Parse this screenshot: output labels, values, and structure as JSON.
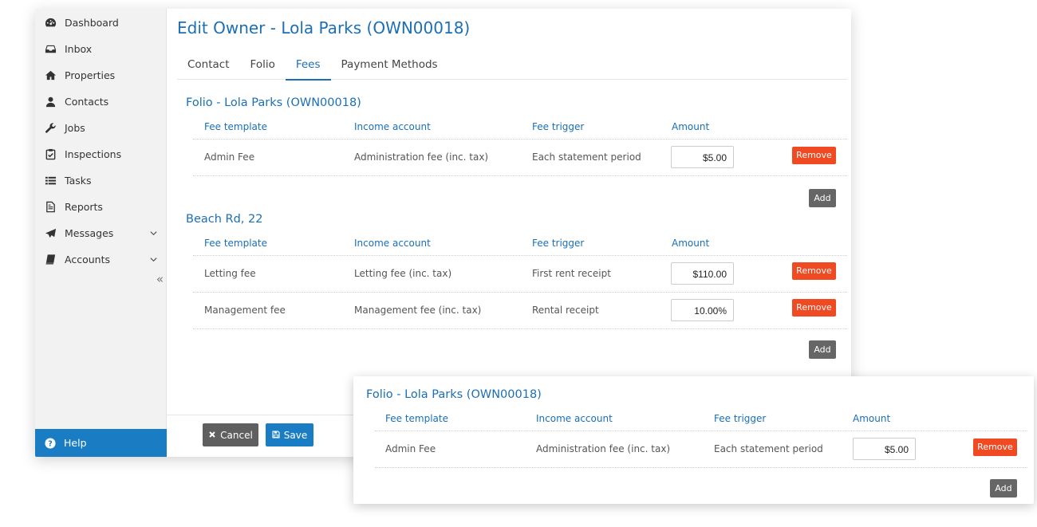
{
  "sidebar": {
    "items": [
      {
        "label": "Dashboard",
        "icon": "dashboard-icon"
      },
      {
        "label": "Inbox",
        "icon": "inbox-icon"
      },
      {
        "label": "Properties",
        "icon": "home-icon"
      },
      {
        "label": "Contacts",
        "icon": "user-icon"
      },
      {
        "label": "Jobs",
        "icon": "wrench-icon"
      },
      {
        "label": "Inspections",
        "icon": "clipboard-check-icon"
      },
      {
        "label": "Tasks",
        "icon": "list-icon"
      },
      {
        "label": "Reports",
        "icon": "document-icon"
      },
      {
        "label": "Messages",
        "icon": "paper-plane-icon"
      },
      {
        "label": "Accounts",
        "icon": "book-icon"
      }
    ],
    "collapse_glyph": "«",
    "help_label": "Help"
  },
  "page_title": "Edit Owner - Lola Parks (OWN00018)",
  "tabs": [
    "Contact",
    "Folio",
    "Fees",
    "Payment Methods"
  ],
  "active_tab": "Fees",
  "columns": {
    "fee_template": "Fee template",
    "income_account": "Income account",
    "fee_trigger": "Fee trigger",
    "amount": "Amount"
  },
  "sections": [
    {
      "title": "Folio - Lola Parks (OWN00018)",
      "rows": [
        {
          "template": "Admin Fee",
          "account": "Administration fee (inc. tax)",
          "trigger": "Each statement period",
          "amount": "$5.00"
        }
      ]
    },
    {
      "title": "Beach Rd, 22",
      "rows": [
        {
          "template": "Letting fee",
          "account": "Letting fee (inc. tax)",
          "trigger": "First rent receipt",
          "amount": "$110.00"
        },
        {
          "template": "Management fee",
          "account": "Management fee (inc. tax)",
          "trigger": "Rental receipt",
          "amount": "10.00%"
        }
      ]
    }
  ],
  "buttons": {
    "remove": "Remove",
    "add": "Add",
    "cancel": "Cancel",
    "save": "Save"
  },
  "popup": {
    "title": "Folio - Lola Parks (OWN00018)",
    "row": {
      "template": "Admin Fee",
      "account": "Administration fee (inc. tax)",
      "trigger": "Each statement period",
      "amount": "$5.00"
    }
  },
  "colors": {
    "accent": "#1a7dc4",
    "remove": "#f04a23",
    "add": "#666666",
    "sidebar_bg": "#f2f2f2"
  }
}
